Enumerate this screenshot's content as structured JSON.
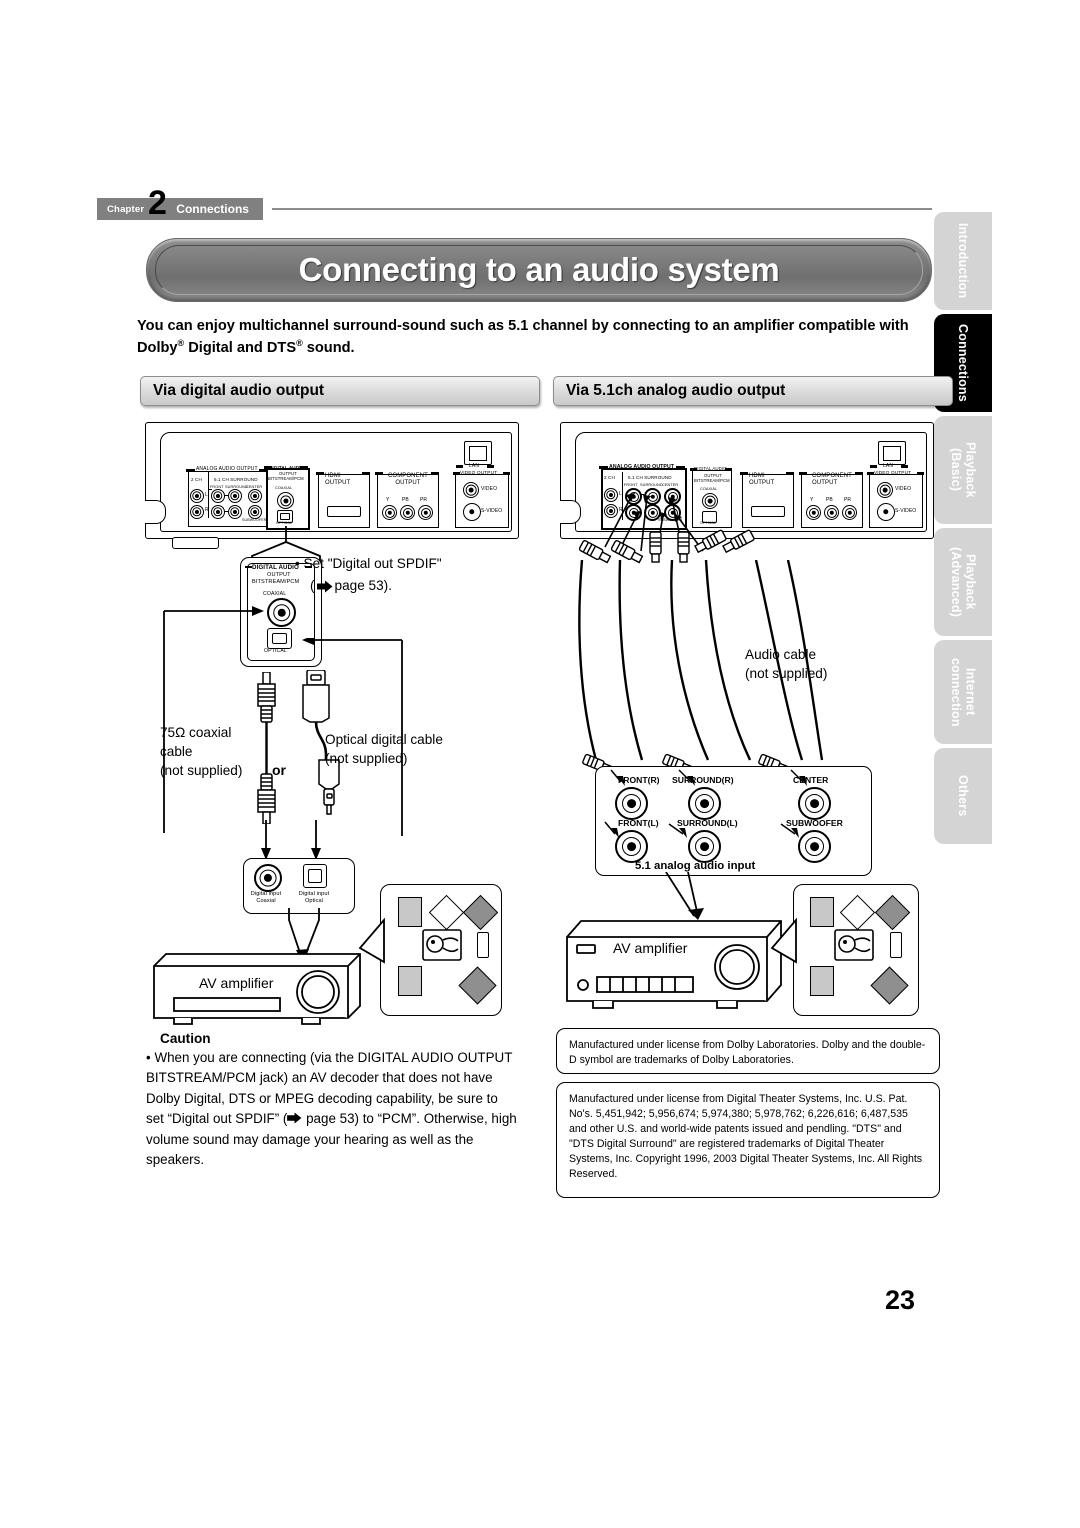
{
  "chapter": {
    "word": "Chapter",
    "number": "2",
    "name": "Connections"
  },
  "page_title": "Connecting to an audio system",
  "intro": {
    "line1": "You can enjoy multichannel surround-sound such as 5.1 channel by connecting to an amplifier compatible with",
    "line2_a": "Dolby",
    "line2_sup1": "®",
    "line2_b": " Digital and DTS",
    "line2_sup2": "®",
    "line2_c": " sound."
  },
  "side_tabs": [
    {
      "label": "Introduction",
      "active": false
    },
    {
      "label": "Connections",
      "active": true
    },
    {
      "label": "Playback\n(Basic)",
      "active": false
    },
    {
      "label": "Playback\n(Advanced)",
      "active": false
    },
    {
      "label": "Internet\nconnection",
      "active": false
    },
    {
      "label": "Others",
      "active": false
    }
  ],
  "left_section": {
    "header": "Via digital audio output",
    "rear_panel": {
      "analog_group_title": "ANALOG AUDIO OUTPUT",
      "analog_2ch": "2 CH",
      "analog_51": "5.1 CH  SURROUND",
      "front": "FRONT",
      "surround": "SURROUND",
      "center": "CENTER",
      "subwoofer": "SUBWOOFER",
      "ch_l": "L",
      "ch_r": "R",
      "digital_group_title": "DIGITAL AUDIO",
      "digital_output": "OUTPUT",
      "digital_bitstream": "BITSTREAM/PCM",
      "coaxial": "COAXIAL",
      "optical": "OPTICAL",
      "hdmi": "HDMI\nOUTPUT",
      "component": "COMPONENT\nOUTPUT",
      "comp_y": "Y",
      "comp_pb": "PB",
      "comp_pr": "PR",
      "video_output": "VIDEO OUTPUT",
      "video": "VIDEO",
      "svideo": "S-VIDEO",
      "lan": "LAN"
    },
    "callout": {
      "title1": "DIGITAL AUDIO",
      "title2": "OUTPUT",
      "title3": "BITSTREAM/PCM",
      "coaxial": "COAXIAL",
      "optical": "OPTICAL"
    },
    "note_set": "Set \"Digital out SPDIF\"",
    "note_page": "page 53).",
    "note_paren": "(",
    "coax_cable": "75Ω coaxial\ncable\n(not supplied)",
    "coax_cable_l1": "75Ω coaxial",
    "coax_cable_l2": "cable",
    "coax_cable_l3": "(not supplied)",
    "or": "or",
    "optical_cable_l1": "Optical digital cable",
    "optical_cable_l2": "(not supplied)",
    "amp_input": {
      "coaxial_l1": "Digital input",
      "coaxial_l2": "Coaxial",
      "optical_l1": "Digital input",
      "optical_l2": "Optical"
    },
    "amplifier_label": "AV amplifier",
    "caution": {
      "title": "Caution",
      "bullet": "•",
      "text_a": "When you are connecting (via the DIGITAL AUDIO OUTPUT BITSTREAM/PCM jack) an AV decoder that does not have Dolby Digital, DTS or MPEG decoding capability, be sure to set “Digital out SPDIF” (",
      "text_b": " page 53) to “PCM”. Otherwise, high volume sound may damage your hearing as well as the speakers."
    }
  },
  "right_section": {
    "header": "Via 5.1ch analog audio output",
    "audio_cable_l1": "Audio cable",
    "audio_cable_l2": "(not supplied)",
    "input_panel": {
      "front_r": "FRONT(R)",
      "front_l": "FRONT(L)",
      "surround_r": "SURROUND(R)",
      "surround_l": "SURROUND(L)",
      "center": "CENTER",
      "subwoofer": "SUBWOOFER",
      "caption": "5.1 analog audio input"
    },
    "amplifier_label": "AV amplifier",
    "notes": [
      "Manufactured under license from Dolby Laboratories. Dolby and the double-D symbol are trademarks of Dolby Laboratories.",
      "Manufactured under license from Digital Theater Systems, Inc. U.S. Pat. No's. 5,451,942; 5,956,674; 5,974,380; 5,978,762; 6,226,616; 6,487,535 and other U.S. and world-wide patents issued and pendling. \"DTS\" and \"DTS Digital Surround\" are registered trademarks of Digital Theater Systems, Inc. Copyright 1996, 2003 Digital Theater Systems, Inc. All Rights Reserved."
    ]
  },
  "page_number": "23",
  "colors": {
    "chapter_gray": "#808080",
    "banner_gray": "#7b7b7b",
    "tab_inactive": "#d4d4d4",
    "tab_active": "#000000",
    "shape_gray": "#8f8f8f",
    "shape_light": "#c8c8c8"
  }
}
